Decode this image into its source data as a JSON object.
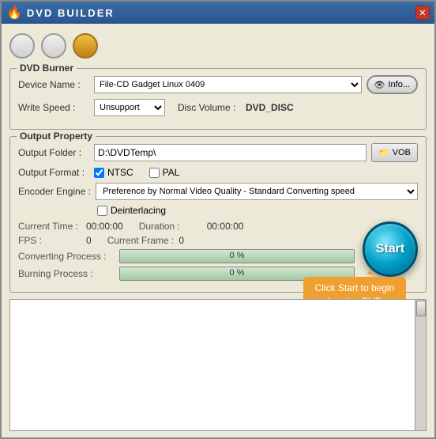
{
  "window": {
    "title": "DVD BUILDER",
    "icon": "🔥"
  },
  "toolbar": {
    "buttons": [
      "",
      "",
      ""
    ]
  },
  "dvd_burner": {
    "label": "DVD Burner",
    "device_name_label": "Device Name :",
    "device_name_value": "File-CD Gadget  Linux   0409",
    "info_button": "Info...",
    "write_speed_label": "Write Speed :",
    "write_speed_value": "Unsupport",
    "disc_volume_label": "Disc Volume :",
    "disc_volume_value": "DVD_DISC"
  },
  "output_property": {
    "label": "Output Property",
    "output_folder_label": "Output Folder :",
    "output_folder_value": "D:\\DVDTemp\\",
    "vob_button": "VOB",
    "output_format_label": "Output Format :",
    "ntsc_label": "NTSC",
    "pal_label": "PAL",
    "ntsc_checked": true,
    "pal_checked": false,
    "encoder_label": "Encoder Engine :",
    "encoder_value": "Preference by Normal Video Quality - Standard Converting speed",
    "deinterlacing_label": "Deinterlacing"
  },
  "stats": {
    "current_time_label": "Current Time :",
    "current_time_value": "00:00:00",
    "duration_label": "Duration :",
    "duration_value": "00:00:00",
    "fps_label": "FPS :",
    "fps_value": "0",
    "current_frame_label": "Current Frame :",
    "current_frame_value": "0"
  },
  "progress": {
    "converting_label": "Converting Process :",
    "converting_percent": "0 %",
    "burning_label": "Burning Process :",
    "burning_percent": "0 %"
  },
  "start_button": {
    "label": "Start"
  },
  "tooltip": {
    "text": "Click Start to begin burning DVD"
  }
}
